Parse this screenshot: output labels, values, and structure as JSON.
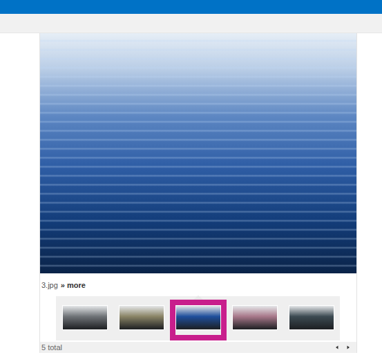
{
  "gallery": {
    "caption": {
      "name": "3.jpg",
      "link": "» more"
    },
    "thumbnails": [
      {
        "selected": false,
        "color": "#6f7377"
      },
      {
        "selected": false,
        "color": "#8a8466"
      },
      {
        "selected": true,
        "color": "#1f4f9c"
      },
      {
        "selected": false,
        "color": "#a8788a"
      },
      {
        "selected": false,
        "color": "#3c4a52"
      }
    ],
    "status": "5 total"
  }
}
